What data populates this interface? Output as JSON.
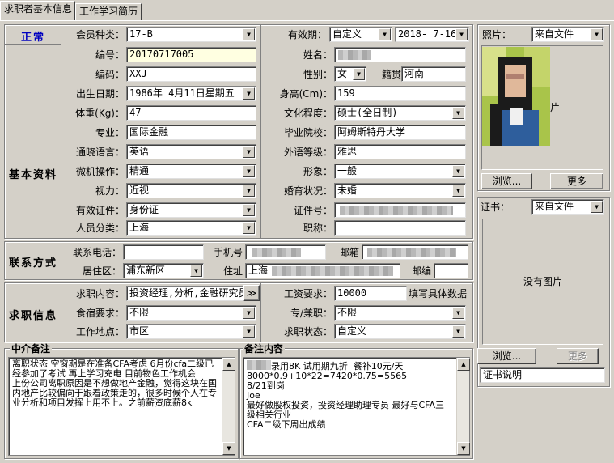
{
  "tabs": [
    "求职者基本信息",
    "工作学习简历"
  ],
  "status": "正常",
  "sections": {
    "basic": "基本资料",
    "contact": "联系方式",
    "job": "求职信息"
  },
  "member_type": {
    "label": "会员种类：",
    "value": "17-B"
  },
  "validity": {
    "label": "有效期：",
    "mode": "自定义",
    "date": "2018- 7-16"
  },
  "id_no": {
    "label": "编号：",
    "value": "20170717005"
  },
  "code": {
    "label": "编码：",
    "value": "XXJ"
  },
  "birth": {
    "label": "出生日期：",
    "value": "1986年 4月11日星期五"
  },
  "weight": {
    "label": "体重(Kg)：",
    "value": "47"
  },
  "major": {
    "label": "专业：",
    "value": "国际金融"
  },
  "language": {
    "label": "通晓语言：",
    "value": "英语"
  },
  "computer": {
    "label": "微机操作：",
    "value": "精通"
  },
  "eyesight": {
    "label": "视力：",
    "value": "近视"
  },
  "cert_type": {
    "label": "有效证件：",
    "value": "身份证"
  },
  "person_type": {
    "label": "人员分类：",
    "value": "上海"
  },
  "name": {
    "label": "姓名："
  },
  "gender": {
    "label": "性别：",
    "value": "女"
  },
  "origin": {
    "label": "籍贯",
    "value": "河南"
  },
  "height": {
    "label": "身高(Cm)：",
    "value": "159"
  },
  "education": {
    "label": "文化程度：",
    "value": "硕士(全日制)"
  },
  "school": {
    "label": "毕业院校：",
    "value": "阿姆斯特丹大学"
  },
  "foreign_level": {
    "label": "外语等级：",
    "value": "雅思"
  },
  "appearance": {
    "label": "形象：",
    "value": "一般"
  },
  "marital": {
    "label": "婚育状况：",
    "value": "未婚"
  },
  "cert_no": {
    "label": "证件号："
  },
  "title_rank": {
    "label": "职称："
  },
  "contact": {
    "phone_label": "联系电话：",
    "mobile_label": "手机号",
    "email_label": "邮箱",
    "district_label": "居住区：",
    "district": "浦东新区",
    "address_label": "住址",
    "address_prefix": "上海",
    "zip_label": "邮编"
  },
  "job": {
    "intent_label": "求职内容：",
    "intent": "投资经理,分析,金融研究员",
    "more_btn": "≫",
    "salary_label": "工资要求：",
    "salary": "10000",
    "salary_note": "填写具体数据",
    "board_label": "食宿要求：",
    "board": "不限",
    "parttime_label": "专/兼职：",
    "parttime": "不限",
    "location_label": "工作地点：",
    "location": "市区",
    "status_label": "求职状态：",
    "status": "自定义"
  },
  "photo": {
    "label": "照片：",
    "source": "来自文件",
    "caption": "片",
    "browse": "浏览...",
    "more": "更多"
  },
  "certificate": {
    "label": "证书：",
    "source": "来自文件",
    "empty": "没有图片",
    "browse": "浏览...",
    "more": "更多",
    "desc": "证书说明"
  },
  "agent_note": {
    "title": "中介备注",
    "text": "离职状态 空窗期是在准备CFA考虑 6月份cfa二级已经参加了考试 再上学习充电 目前物色工作机会\n上份公司离职原因是不想做地产金融，觉得这块在国内地产比较偏向于跟着政策走的，很多时候个人在专业分析和项目发挥上用不上。之前薪资底薪8k"
  },
  "remark": {
    "title": "备注内容",
    "text": "录用8K 试用期九折  餐补10元/天\n8000*0.9+10*22=7420*0.75=5565\n8/21到岗\nJoe\n最好做股权投资，投资经理助理专员 最好与CFA三级相关行业\nCFA二级下周出成绩"
  }
}
